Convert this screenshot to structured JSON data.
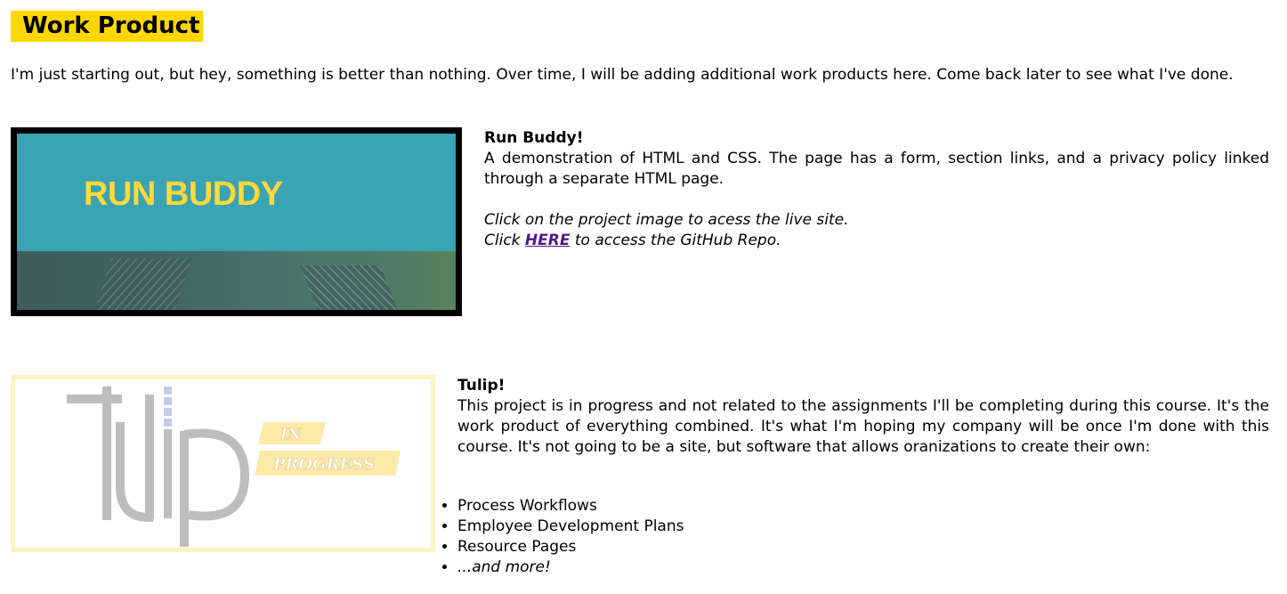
{
  "page": {
    "heading": "Work Product",
    "intro": "I'm just starting out, but hey, something is better than nothing. Over time, I will be adding additional work products here. Come back later to see what I've done."
  },
  "projects": [
    {
      "title": "Run Buddy!",
      "image_text": "RUN BUDDY",
      "description": "A demonstration of HTML and CSS. The page has a form, section links, and a privacy policy linked through a separate HTML page.",
      "note": "Click on the project image to acess the live site.",
      "repo_prefix": "Click ",
      "repo_link": "HERE",
      "repo_suffix": " to access the GitHub Repo."
    },
    {
      "title": "Tulip!",
      "logo_text": "tulip",
      "badge_line1": "IN",
      "badge_line2": "PROGRESS",
      "description": "This project is in progress and not related to the assignments I'll be completing during this course. It's the work product of everything combined. It's what I'm hoping my company will be once I'm done with this course. It's not going to be a site, but software that allows oranizations to create their own:",
      "features": [
        "Process Workflows",
        "Employee Development Plans",
        "Resource Pages",
        "...and more!"
      ]
    }
  ],
  "colors": {
    "heading_bg": "#ffd700",
    "runbuddy_teal": "#3aa3b4",
    "runbuddy_yellow": "#fdd93a",
    "link": "#551a8b",
    "tulip_frame": "#fdf3c6",
    "progress_badge": "#fde9a8"
  }
}
